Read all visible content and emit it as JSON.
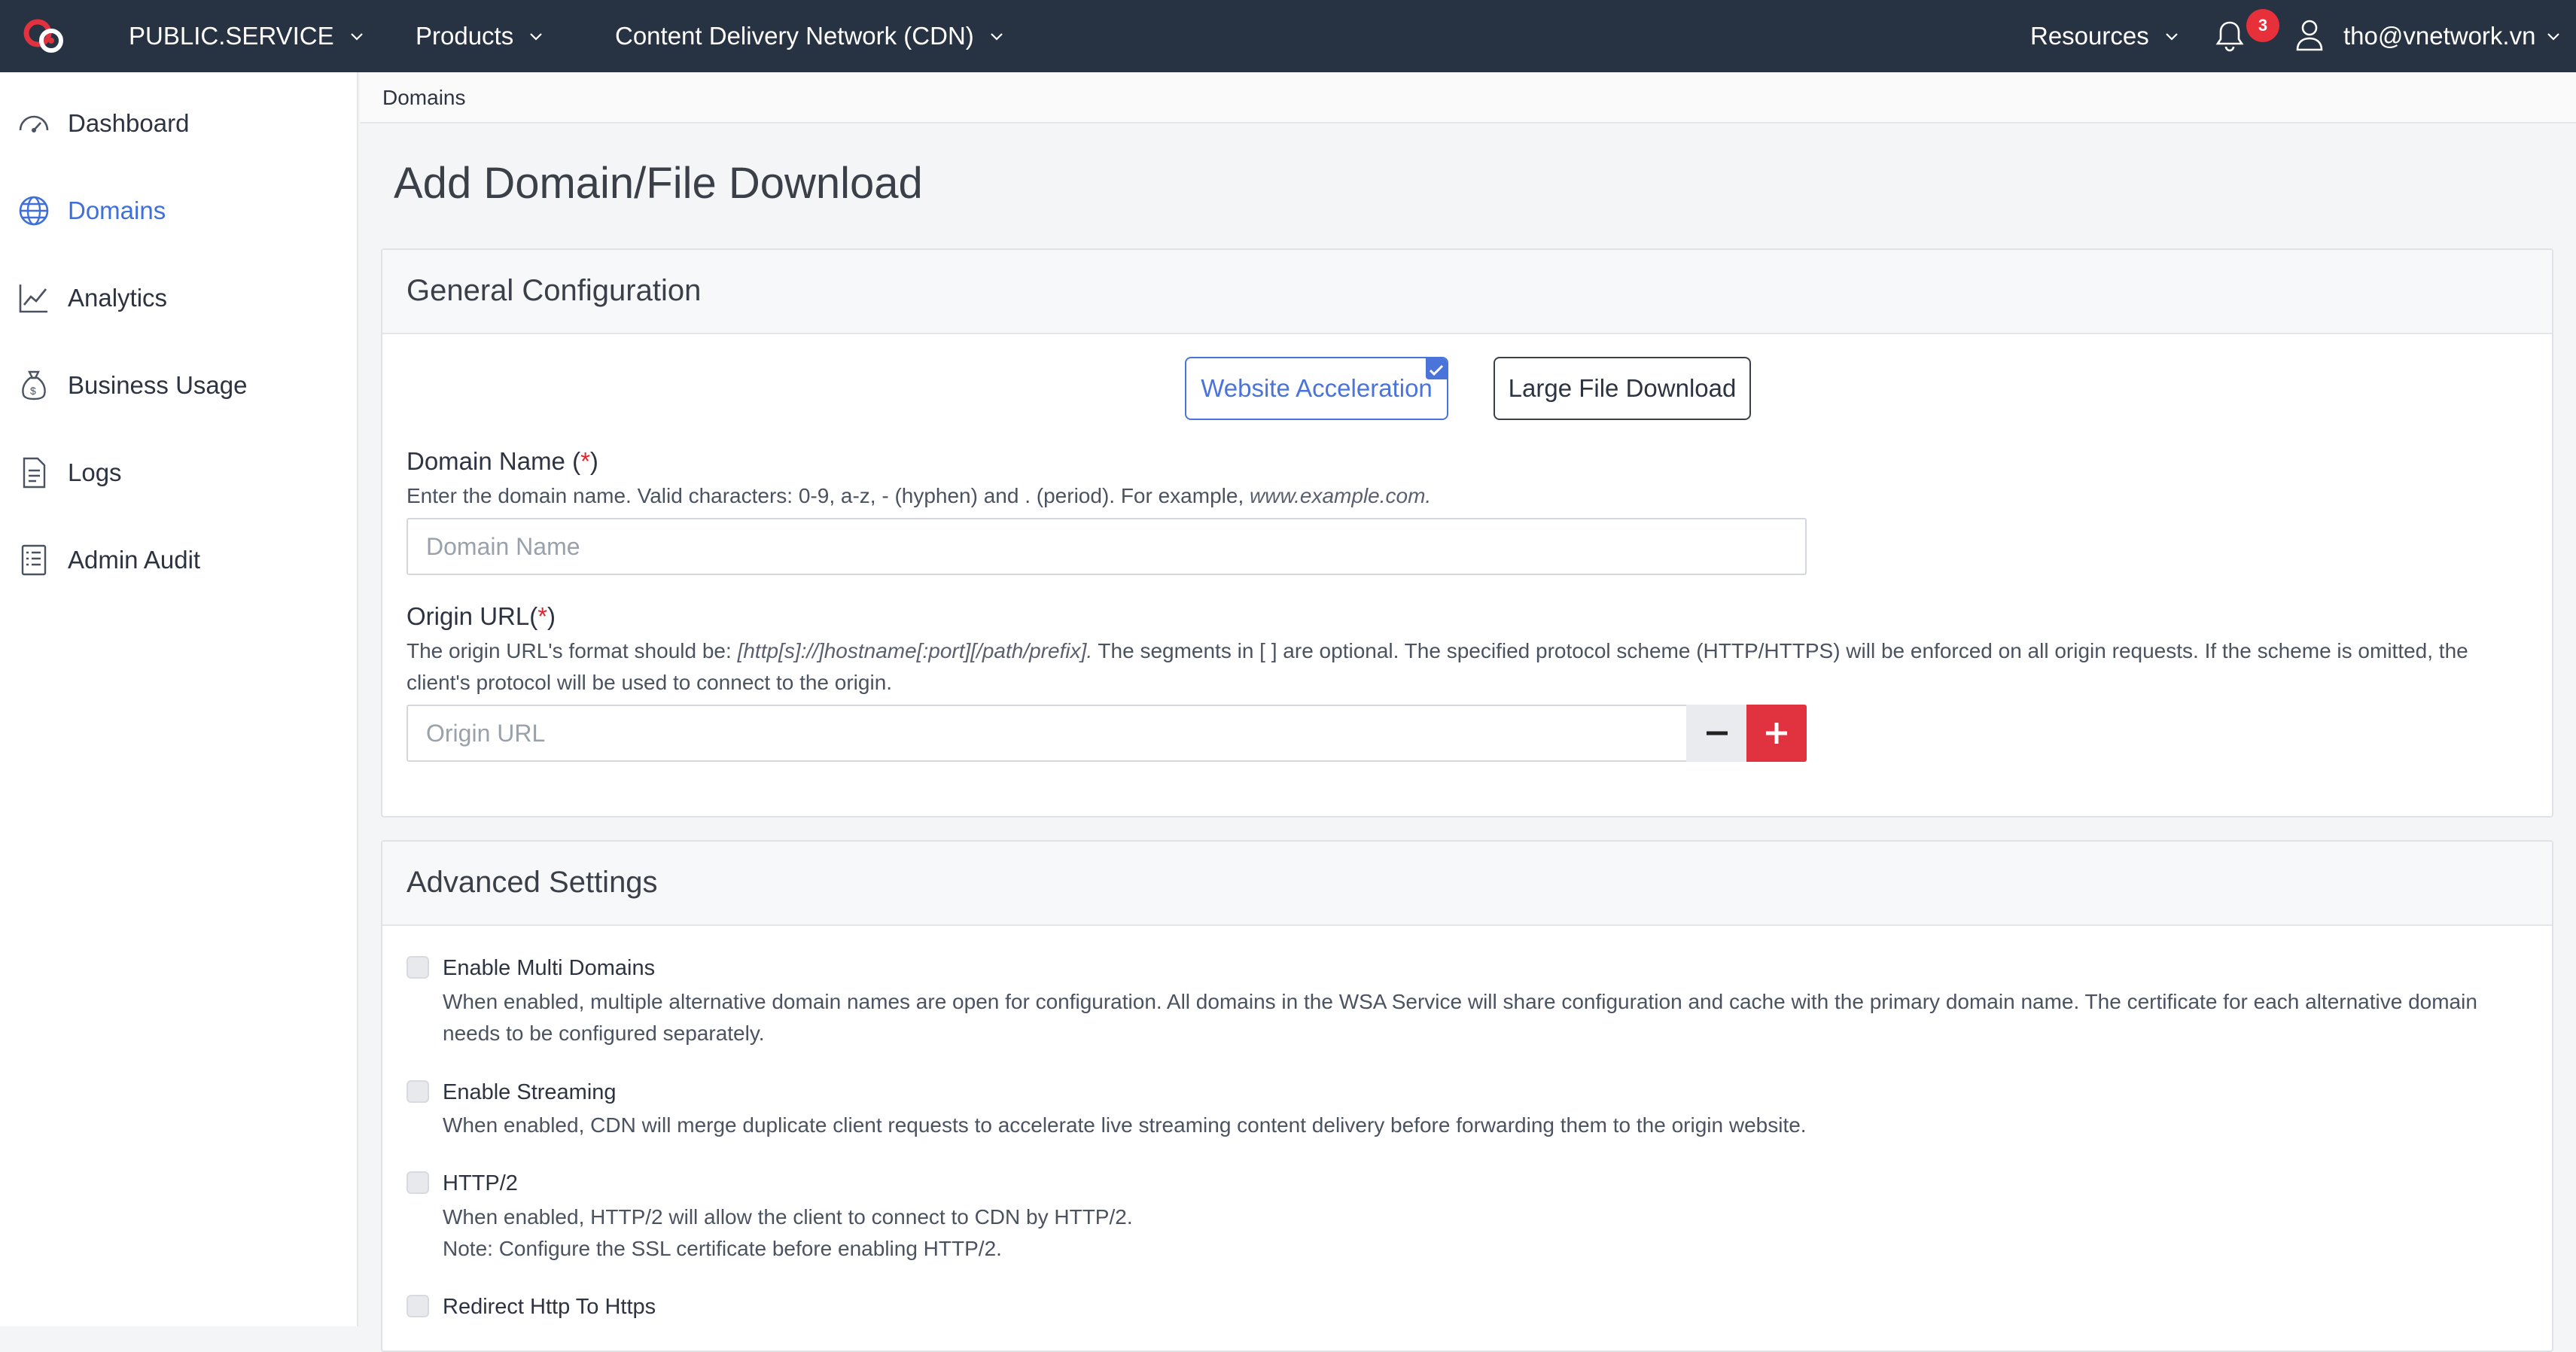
{
  "topbar": {
    "workspace": "PUBLIC.SERVICE",
    "products": "Products",
    "service": "Content Delivery Network (CDN)",
    "resources": "Resources",
    "notification_count": "3",
    "user_email": "tho@vnetwork.vn"
  },
  "sidebar": {
    "items": [
      {
        "label": "Dashboard",
        "icon": "gauge-icon"
      },
      {
        "label": "Domains",
        "icon": "globe-icon",
        "active": true
      },
      {
        "label": "Analytics",
        "icon": "line-chart-icon"
      },
      {
        "label": "Business Usage",
        "icon": "money-bag-icon"
      },
      {
        "label": "Logs",
        "icon": "document-icon"
      },
      {
        "label": "Admin Audit",
        "icon": "list-icon"
      }
    ]
  },
  "breadcrumb": "Domains",
  "page_title": "Add Domain/File Download",
  "general": {
    "title": "General Configuration",
    "option_selected": "Website Acceleration",
    "option_other": "Large File Download",
    "domain_label": "Domain Name (",
    "domain_req": "*",
    "domain_label_end": ")",
    "domain_help": "Enter the domain name. Valid characters: 0-9, a-z, - (hyphen) and . (period). For example, ",
    "domain_help_example": "www.example.com.",
    "domain_placeholder": "Domain Name",
    "origin_label": "Origin URL(",
    "origin_req": "*",
    "origin_label_end": ")",
    "origin_help_start": "The origin URL's format should be: ",
    "origin_help_format": "[http[s]://]hostname[:port][/path/prefix].",
    "origin_help_rest": " The segments in [ ] are optional. The specified protocol scheme (HTTP/HTTPS) will be enforced on all origin requests. If the scheme is omitted, the client's protocol will be used to connect to the origin.",
    "origin_placeholder": "Origin URL"
  },
  "advanced": {
    "title": "Advanced Settings",
    "options": [
      {
        "title": "Enable Multi Domains",
        "desc": "When enabled, multiple alternative domain names are open for configuration. All domains in the WSA Service will share configuration and cache with the primary domain name. The certificate for each alternative domain needs to be configured separately.",
        "checked": false
      },
      {
        "title": "Enable Streaming",
        "desc": "When enabled, CDN will merge duplicate client requests to accelerate live streaming content delivery before forwarding them to the origin website.",
        "checked": false
      },
      {
        "title": "HTTP/2",
        "desc": "When enabled, HTTP/2 will allow the client to connect to CDN by HTTP/2.",
        "desc2": "Note: Configure the SSL certificate before enabling HTTP/2.",
        "checked": false
      },
      {
        "title": "Redirect Http To Https",
        "checked": false
      }
    ]
  },
  "colors": {
    "topbar": "#273242",
    "accent": "#4a74d9",
    "danger": "#e0323f"
  }
}
